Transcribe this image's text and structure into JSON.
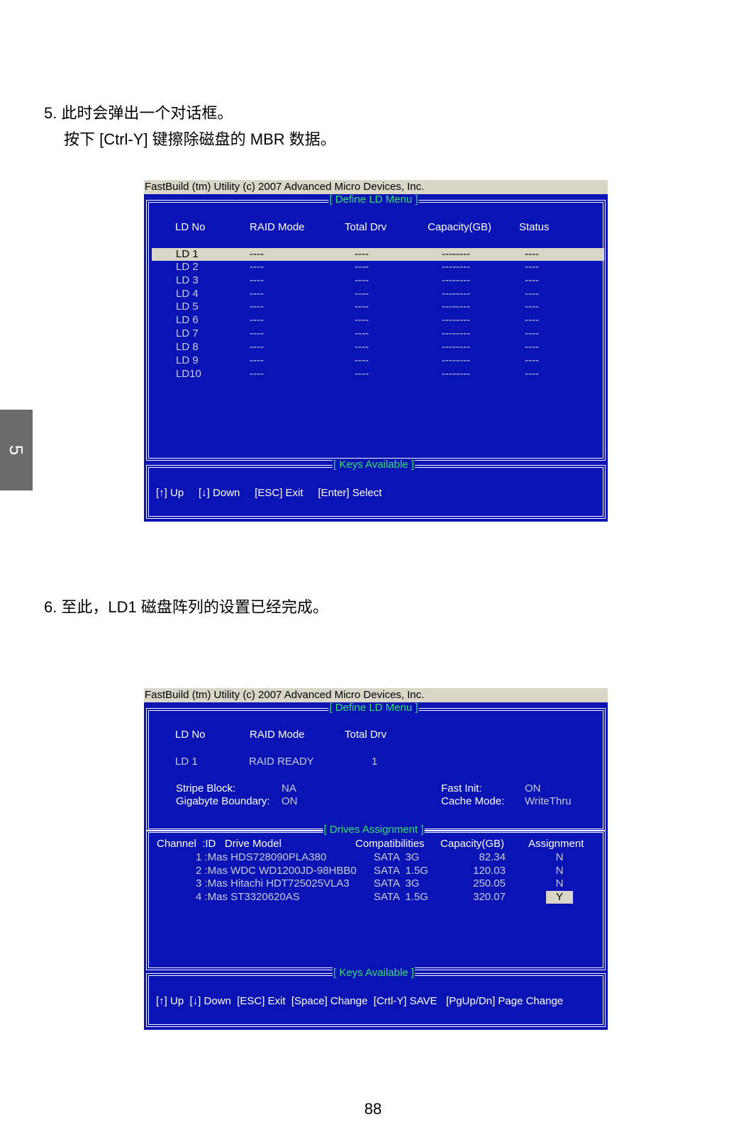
{
  "side_tab": "5",
  "step5": {
    "num": "5.",
    "text": "此时会弹出一个对话框。",
    "subtext": "按下 [Ctrl-Y] 键擦除磁盘的 MBR 数据。"
  },
  "step6": {
    "num": "6.",
    "text": "至此，LD1 磁盘阵列的设置已经完成。"
  },
  "page_number": "88",
  "screen1": {
    "titlebar": "FastBuild (tm) Utility (c) 2007 Advanced Micro Devices, Inc.",
    "menu_title": "[ Define LD Menu ]",
    "headers": [
      "LD No",
      "RAID Mode",
      "Total Drv",
      "Capacity(GB)",
      "Status"
    ],
    "rows": [
      [
        "LD  1",
        "----",
        "----",
        "--------",
        "----"
      ],
      [
        "LD  2",
        "----",
        "----",
        "--------",
        "----"
      ],
      [
        "LD  3",
        "----",
        "----",
        "--------",
        "----"
      ],
      [
        "LD  4",
        "----",
        "----",
        "--------",
        "----"
      ],
      [
        "LD  5",
        "----",
        "----",
        "--------",
        "----"
      ],
      [
        "LD  6",
        "----",
        "----",
        "--------",
        "----"
      ],
      [
        "LD  7",
        "----",
        "----",
        "--------",
        "----"
      ],
      [
        "LD  8",
        "----",
        "----",
        "--------",
        "----"
      ],
      [
        "LD  9",
        "----",
        "----",
        "--------",
        "----"
      ],
      [
        "LD10",
        "----",
        "----",
        "--------",
        "----"
      ]
    ],
    "keys_title": "[ Keys Available ]",
    "keys": "[↑] Up     [↓] Down     [ESC] Exit     [Enter] Select"
  },
  "screen2": {
    "titlebar": "FastBuild (tm) Utility (c) 2007 Advanced Micro Devices, Inc.",
    "menu_title": "[ Define LD Menu ]",
    "headers": [
      "LD No",
      "RAID Mode",
      "Total Drv"
    ],
    "ld_row": [
      "LD  1",
      "RAID READY",
      "1"
    ],
    "stripe_label": "Stripe Block:",
    "stripe_value": "NA",
    "gigabyte_label": "Gigabyte Boundary:",
    "gigabyte_value": "ON",
    "fastinit_label": "Fast Init:",
    "fastinit_value": "ON",
    "cache_label": "Cache Mode:",
    "cache_value": "WriteThru",
    "drives_title": "[ Drives Assignment ]",
    "drive_headers": [
      "Channel  :ID   Drive Model",
      "Compatibilities",
      "Capacity(GB)",
      "Assignment"
    ],
    "drives": [
      {
        "id": "1 :Mas HDS728090PLA380",
        "compat": "SATA  3G",
        "cap": "82.34",
        "assign": "N"
      },
      {
        "id": "2 :Mas WDC WD1200JD-98HBB0",
        "compat": "SATA  1.5G",
        "cap": "120.03",
        "assign": "N"
      },
      {
        "id": "3 :Mas Hitachi HDT725025VLA3",
        "compat": "SATA  3G",
        "cap": "250.05",
        "assign": "N"
      },
      {
        "id": "4 :Mas ST3320620AS",
        "compat": "SATA  1.5G",
        "cap": "320.07",
        "assign": "Y"
      }
    ],
    "keys_title": "[ Keys Available ]",
    "keys": "[↑] Up  [↓] Down  [ESC] Exit  [Space] Change  [Crtl-Y] SAVE   [PgUp/Dn] Page Change"
  }
}
